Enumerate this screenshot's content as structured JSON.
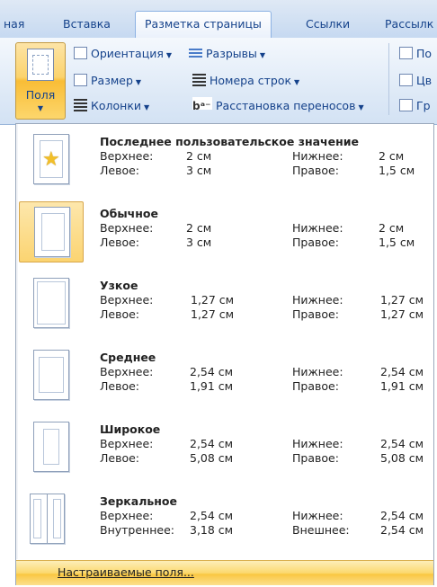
{
  "tabs": [
    {
      "label": "ная"
    },
    {
      "label": "Вставка"
    },
    {
      "label": "Разметка страницы"
    },
    {
      "label": "Ссылки"
    },
    {
      "label": "Рассылк"
    }
  ],
  "ribbon": {
    "fields_button": {
      "label": "Поля"
    },
    "orientation": {
      "label": "Ориентация"
    },
    "size": {
      "label": "Размер"
    },
    "columns": {
      "label": "Колонки"
    },
    "breaks": {
      "label": "Разрывы"
    },
    "line_numbers": {
      "label": "Номера строк"
    },
    "hyphenation": {
      "label": "Расстановка переносов",
      "icon_text": "bᵃ⁻"
    },
    "right_items": [
      "По",
      "Цв",
      "Гр"
    ]
  },
  "presets": [
    {
      "title": "Последнее пользовательское значение",
      "left_labels": [
        "Верхнее:",
        "Левое:"
      ],
      "left_values": [
        "2 см",
        "3 см"
      ],
      "right_labels": [
        "Нижнее:",
        "Правое:"
      ],
      "right_values": [
        "2 см",
        "1,5 см"
      ],
      "icon": "custom-margins-star-icon"
    },
    {
      "title": "Обычное",
      "left_labels": [
        "Верхнее:",
        "Левое:"
      ],
      "left_values": [
        "2 см",
        "3 см"
      ],
      "right_labels": [
        "Нижнее:",
        "Правое:"
      ],
      "right_values": [
        "2 см",
        "1,5 см"
      ],
      "icon": "normal-margins-icon",
      "selected": true
    },
    {
      "title": "Узкое",
      "left_labels": [
        "Верхнее:",
        "Левое:"
      ],
      "left_values": [
        "1,27 см",
        "1,27 см"
      ],
      "right_labels": [
        "Нижнее:",
        "Правое:"
      ],
      "right_values": [
        "1,27 см",
        "1,27 см"
      ],
      "icon": "narrow-margins-icon"
    },
    {
      "title": "Среднее",
      "left_labels": [
        "Верхнее:",
        "Левое:"
      ],
      "left_values": [
        "2,54 см",
        "1,91 см"
      ],
      "right_labels": [
        "Нижнее:",
        "Правое:"
      ],
      "right_values": [
        "2,54 см",
        "1,91 см"
      ],
      "icon": "moderate-margins-icon"
    },
    {
      "title": "Широкое",
      "left_labels": [
        "Верхнее:",
        "Левое:"
      ],
      "left_values": [
        "2,54 см",
        "5,08 см"
      ],
      "right_labels": [
        "Нижнее:",
        "Правое:"
      ],
      "right_values": [
        "2,54 см",
        "5,08 см"
      ],
      "icon": "wide-margins-icon"
    },
    {
      "title": "Зеркальное",
      "left_labels": [
        "Верхнее:",
        "Внутреннее:"
      ],
      "left_values": [
        "2,54 см",
        "3,18 см"
      ],
      "right_labels": [
        "Нижнее:",
        "Внешнее:"
      ],
      "right_values": [
        "2,54 см",
        "2,54 см"
      ],
      "icon": "mirrored-margins-icon"
    }
  ],
  "custom_margins": {
    "label": "Настраиваемые поля..."
  },
  "colors": {
    "accent": "#fbd36d",
    "ribbon_text": "#15428b"
  }
}
